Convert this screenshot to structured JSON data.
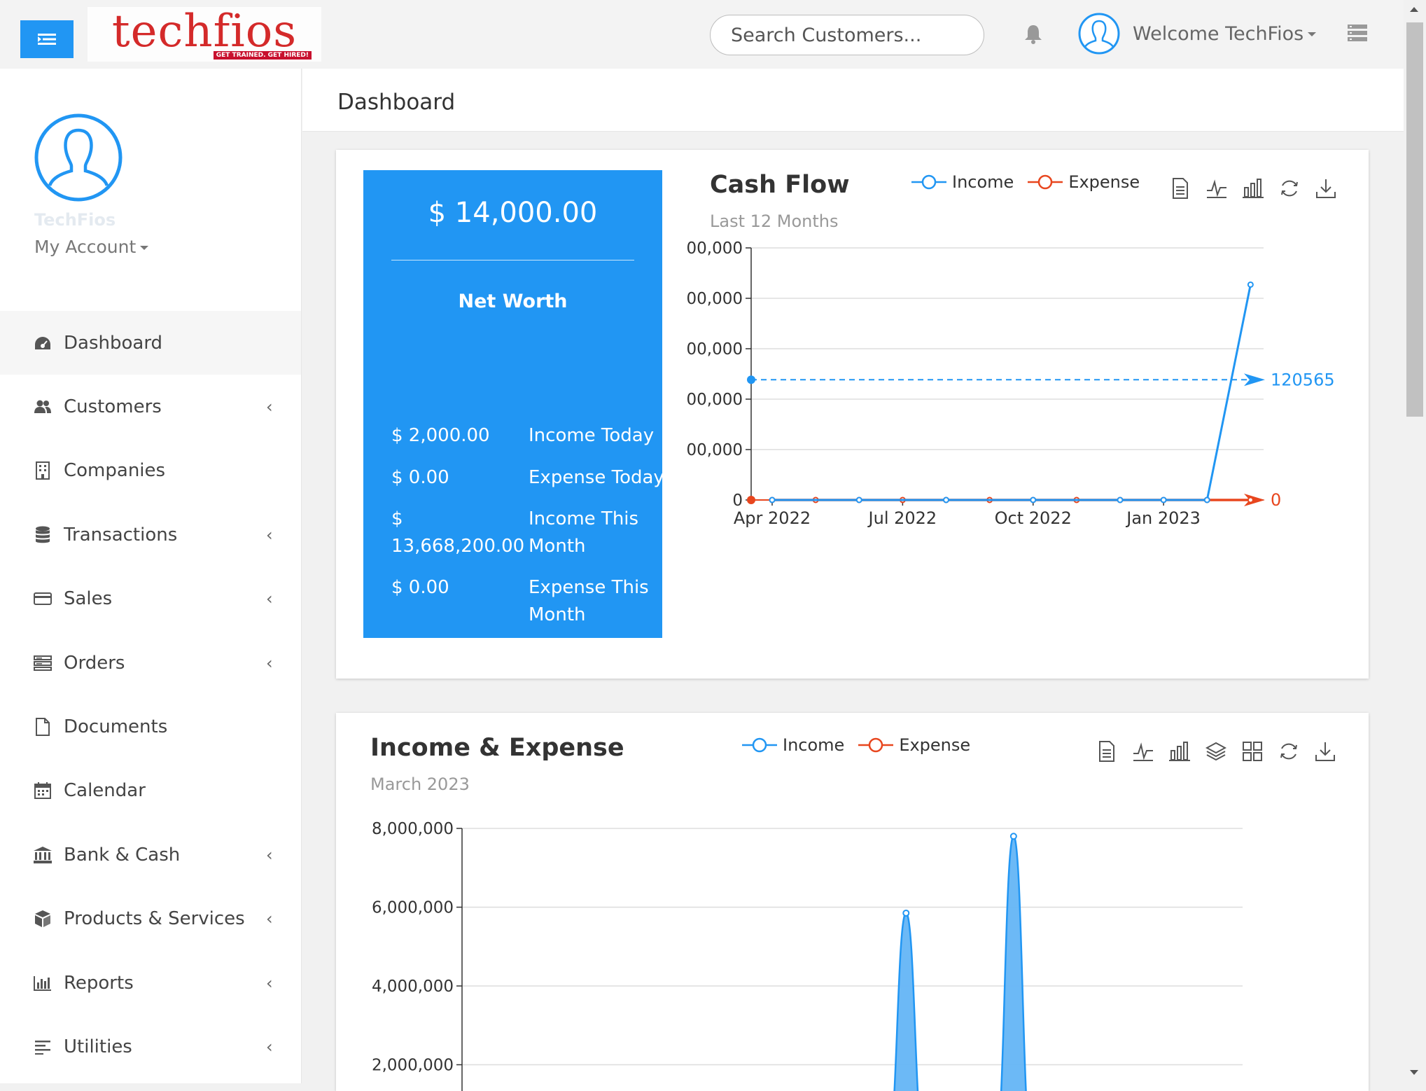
{
  "header": {
    "logo_text": "techfios",
    "logo_tagline": "GET TRAINED. GET HIRED!",
    "search_placeholder": "Search Customers...",
    "welcome": "Welcome TechFios"
  },
  "sidebar": {
    "profile_name": "TechFios",
    "my_account": "My Account",
    "items": [
      {
        "label": "Dashboard",
        "icon": "dashboard-icon",
        "has_submenu": false,
        "active": true
      },
      {
        "label": "Customers",
        "icon": "users-icon",
        "has_submenu": true
      },
      {
        "label": "Companies",
        "icon": "building-icon",
        "has_submenu": false
      },
      {
        "label": "Transactions",
        "icon": "database-icon",
        "has_submenu": true
      },
      {
        "label": "Sales",
        "icon": "credit-card-icon",
        "has_submenu": true
      },
      {
        "label": "Orders",
        "icon": "server-icon",
        "has_submenu": true
      },
      {
        "label": "Documents",
        "icon": "file-icon",
        "has_submenu": false
      },
      {
        "label": "Calendar",
        "icon": "calendar-icon",
        "has_submenu": false
      },
      {
        "label": "Bank & Cash",
        "icon": "bank-icon",
        "has_submenu": true
      },
      {
        "label": "Products & Services",
        "icon": "cube-icon",
        "has_submenu": true
      },
      {
        "label": "Reports",
        "icon": "bar-chart-icon",
        "has_submenu": true
      },
      {
        "label": "Utilities",
        "icon": "align-left-icon",
        "has_submenu": true
      }
    ],
    "chevron": "‹"
  },
  "page": {
    "title": "Dashboard"
  },
  "net_worth": {
    "amount": "$ 14,000.00",
    "label": "Net Worth",
    "rows": [
      {
        "value": "$ 2,000.00",
        "label": "Income Today"
      },
      {
        "value": "$ 0.00",
        "label": "Expense Today"
      },
      {
        "value": "$ 13,668,200.00",
        "label": "Income This Month"
      },
      {
        "value": "$ 0.00",
        "label": "Expense This Month"
      }
    ]
  },
  "colors": {
    "income": "#2196f3",
    "expense": "#e8461e",
    "accent": "#2196f3"
  },
  "chart_data": [
    {
      "type": "line",
      "title": "Cash Flow",
      "subtitle": "Last 12 Months",
      "legend": [
        "Income",
        "Expense"
      ],
      "x_ticks": [
        "Apr 2022",
        "Jul 2022",
        "Oct 2022",
        "Jan 2023"
      ],
      "y_tick_labels": [
        "0",
        "00,000",
        "00,000",
        "00,000",
        "00,000",
        "00,000"
      ],
      "series": [
        {
          "name": "Income",
          "values": [
            0,
            0,
            0,
            0,
            0,
            0,
            0,
            0,
            0,
            2000,
            0,
            13668200
          ]
        },
        {
          "name": "Expense",
          "values": [
            0,
            0,
            0,
            0,
            0,
            0,
            0,
            0,
            0,
            0,
            0,
            0
          ]
        }
      ],
      "markline": [
        {
          "series": "Income",
          "value": "120565"
        },
        {
          "series": "Expense",
          "value": "0"
        }
      ]
    },
    {
      "type": "area",
      "title": "Income & Expense",
      "subtitle": "March 2023",
      "legend": [
        "Income",
        "Expense"
      ],
      "y_ticks": [
        "8,000,000",
        "6,000,000",
        "4,000,000",
        "2,000,000"
      ],
      "ylim": [
        0,
        8000000
      ],
      "series": [
        {
          "name": "Income",
          "values": [
            0,
            0,
            0,
            0,
            0,
            0,
            0,
            0,
            0,
            0,
            0,
            0,
            0,
            0,
            0,
            0,
            0,
            0,
            0,
            0,
            0,
            0,
            0,
            0,
            5850000,
            0,
            0,
            0,
            0,
            0,
            7800000,
            0,
            0,
            0,
            0,
            0,
            0,
            0,
            0,
            0,
            0,
            0,
            0
          ]
        }
      ]
    }
  ]
}
